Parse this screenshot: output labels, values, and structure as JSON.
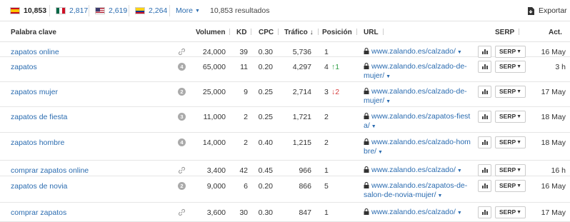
{
  "topbar": {
    "countries": [
      {
        "flag": "es",
        "count": "10,853",
        "active": true
      },
      {
        "flag": "mx",
        "count": "2,817",
        "active": false
      },
      {
        "flag": "us",
        "count": "2,619",
        "active": false
      },
      {
        "flag": "co",
        "count": "2,264",
        "active": false
      }
    ],
    "more_label": "More",
    "results_label": "10,853 resultados",
    "export_label": "Exportar"
  },
  "columns": {
    "keyword": "Palabra clave",
    "volume": "Volumen",
    "kd": "KD",
    "cpc": "CPC",
    "traffic": "Tráfico",
    "position": "Posición",
    "url": "URL",
    "serp": "SERP",
    "updated": "Act."
  },
  "serp_label": "SERP",
  "rows": [
    {
      "keyword": "zapatos online",
      "badge": "link",
      "volume": "24,000",
      "kd": "39",
      "cpc": "0.30",
      "traffic": "5,736",
      "position": "1",
      "change": "",
      "change_dir": "",
      "url": "www.zalando.es/calzado/",
      "updated": "16 May"
    },
    {
      "keyword": "zapatos",
      "badge": "4",
      "volume": "65,000",
      "kd": "11",
      "cpc": "0.20",
      "traffic": "4,297",
      "position": "4",
      "change": "1",
      "change_dir": "up",
      "url": "www.zalando.es/calzado-de-mujer/",
      "updated": "3 h"
    },
    {
      "keyword": "zapatos mujer",
      "badge": "2",
      "volume": "25,000",
      "kd": "9",
      "cpc": "0.25",
      "traffic": "2,714",
      "position": "3",
      "change": "2",
      "change_dir": "down",
      "url": "www.zalando.es/calzado-de-mujer/",
      "updated": "17 May"
    },
    {
      "keyword": "zapatos de fiesta",
      "badge": "3",
      "volume": "11,000",
      "kd": "2",
      "cpc": "0.25",
      "traffic": "1,721",
      "position": "2",
      "change": "",
      "change_dir": "",
      "url": "www.zalando.es/zapatos-fiesta/",
      "updated": "18 May"
    },
    {
      "keyword": "zapatos hombre",
      "badge": "4",
      "volume": "14,000",
      "kd": "2",
      "cpc": "0.40",
      "traffic": "1,215",
      "position": "2",
      "change": "",
      "change_dir": "",
      "url": "www.zalando.es/calzado-hombre/",
      "updated": "18 May"
    },
    {
      "keyword": "comprar zapatos online",
      "badge": "link",
      "volume": "3,400",
      "kd": "42",
      "cpc": "0.45",
      "traffic": "966",
      "position": "1",
      "change": "",
      "change_dir": "",
      "url": "www.zalando.es/calzado/",
      "updated": "16 h"
    },
    {
      "keyword": "zapatos de novia",
      "badge": "2",
      "volume": "9,000",
      "kd": "6",
      "cpc": "0.20",
      "traffic": "866",
      "position": "5",
      "change": "",
      "change_dir": "",
      "url": "www.zalando.es/zapatos-de-salon-de-novia-mujer/",
      "updated": "16 May"
    },
    {
      "keyword": "comprar zapatos",
      "badge": "link",
      "volume": "3,600",
      "kd": "30",
      "cpc": "0.30",
      "traffic": "847",
      "position": "1",
      "change": "",
      "change_dir": "",
      "url": "www.zalando.es/calzado/",
      "updated": "17 May"
    }
  ]
}
